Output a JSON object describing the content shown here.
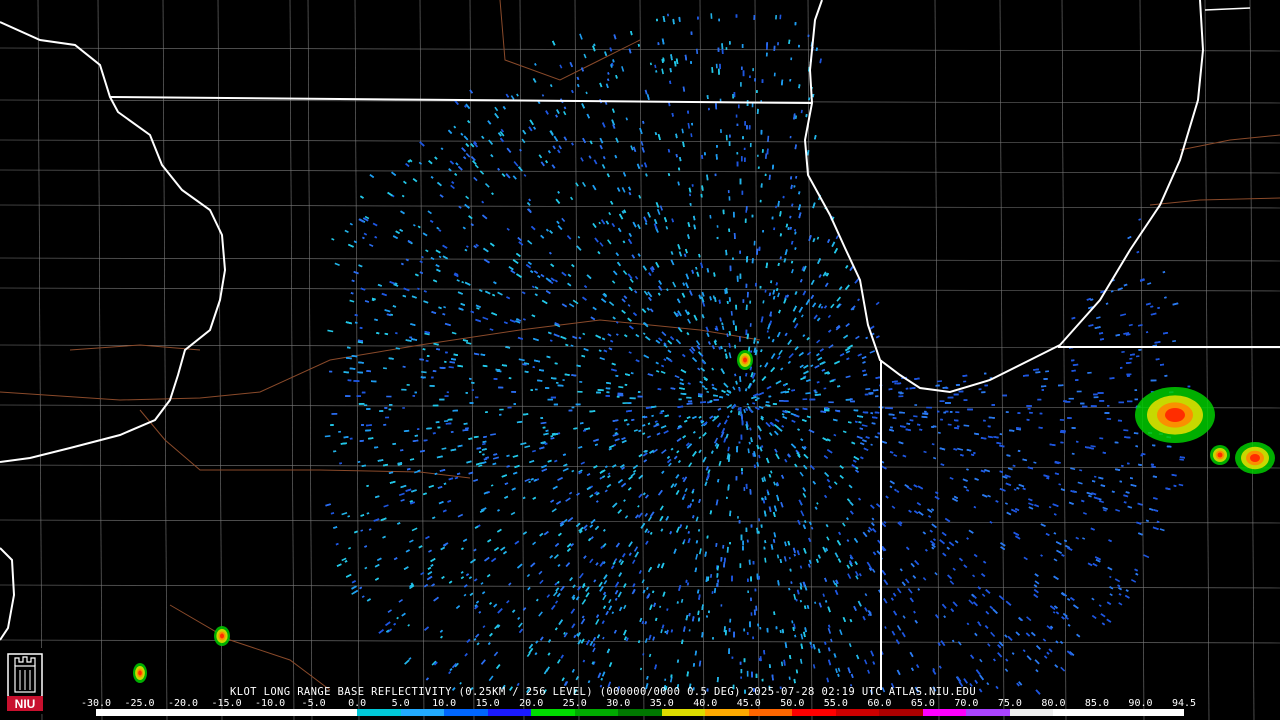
{
  "product": {
    "caption": "KLOT LONG RANGE BASE REFLECTIVITY (0.25KM / 256 LEVEL) (000000/0000 0.5 DEG) 2025-07-28 02:19 UTC  ATLAS.NIU.EDU"
  },
  "colorbar": {
    "ticks": [
      "-30.0",
      "-25.0",
      "-20.0",
      "-15.0",
      "-10.0",
      "-5.0",
      "0.0",
      "5.0",
      "10.0",
      "15.0",
      "20.0",
      "25.0",
      "30.0",
      "35.0",
      "40.0",
      "45.0",
      "50.0",
      "55.0",
      "60.0",
      "65.0",
      "70.0",
      "75.0",
      "80.0",
      "85.0",
      "90.0",
      "94.5"
    ],
    "colors": [
      "#ffffff",
      "#ffffff",
      "#ffffff",
      "#ffffff",
      "#ffffff",
      "#ffffff",
      "#00c8d8",
      "#22aaff",
      "#0066ff",
      "#1a1aff",
      "#00dd00",
      "#00aa00",
      "#007700",
      "#dddd00",
      "#ffaa00",
      "#ff6600",
      "#ff0000",
      "#cc0000",
      "#aa0000",
      "#ff00ff",
      "#aa44ff",
      "#eeeeee",
      "#ffffff",
      "#ffffff",
      "#ffffff"
    ]
  },
  "logo": {
    "text": "NIU",
    "color": "#c8102e"
  },
  "map": {
    "background": "#000000",
    "state_border_color": "#ffffff",
    "county_border_color": "#7a7a7a",
    "highway_color": "#8a4a2a"
  }
}
